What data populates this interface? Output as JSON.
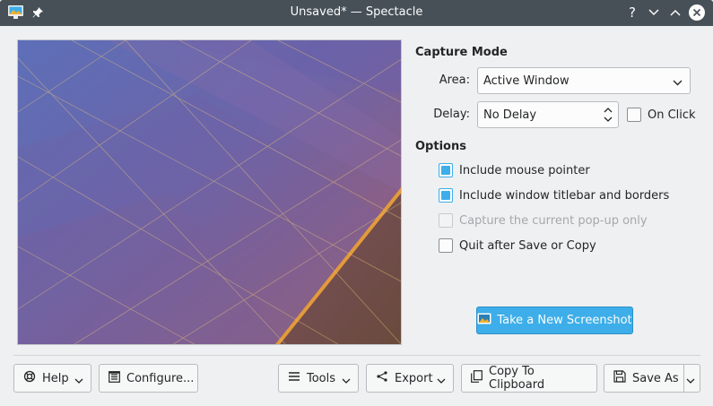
{
  "window": {
    "title": "Unsaved* — Spectacle",
    "controls": {
      "help": "?",
      "minimize": "minimize",
      "maximize": "maximize",
      "close": "close"
    }
  },
  "capture_mode": {
    "heading": "Capture Mode",
    "area_label": "Area:",
    "area_value": "Active Window",
    "delay_label": "Delay:",
    "delay_value": "No Delay",
    "on_click_label": "On Click",
    "on_click_checked": false
  },
  "options": {
    "heading": "Options",
    "items": [
      {
        "label": "Include mouse pointer",
        "checked": true,
        "enabled": true
      },
      {
        "label": "Include window titlebar and borders",
        "checked": true,
        "enabled": true
      },
      {
        "label": "Capture the current pop-up only",
        "checked": false,
        "enabled": false
      },
      {
        "label": "Quit after Save or Copy",
        "checked": false,
        "enabled": true
      }
    ]
  },
  "take_screenshot_label": "Take a New Screenshot",
  "bottom_bar": {
    "help": "Help",
    "configure": "Configure...",
    "tools": "Tools",
    "export": "Export",
    "copy": "Copy To Clipboard",
    "save_as": "Save As"
  },
  "colors": {
    "accent": "#3daee9",
    "titlebar": "#475057",
    "window_bg": "#eff0f1"
  }
}
